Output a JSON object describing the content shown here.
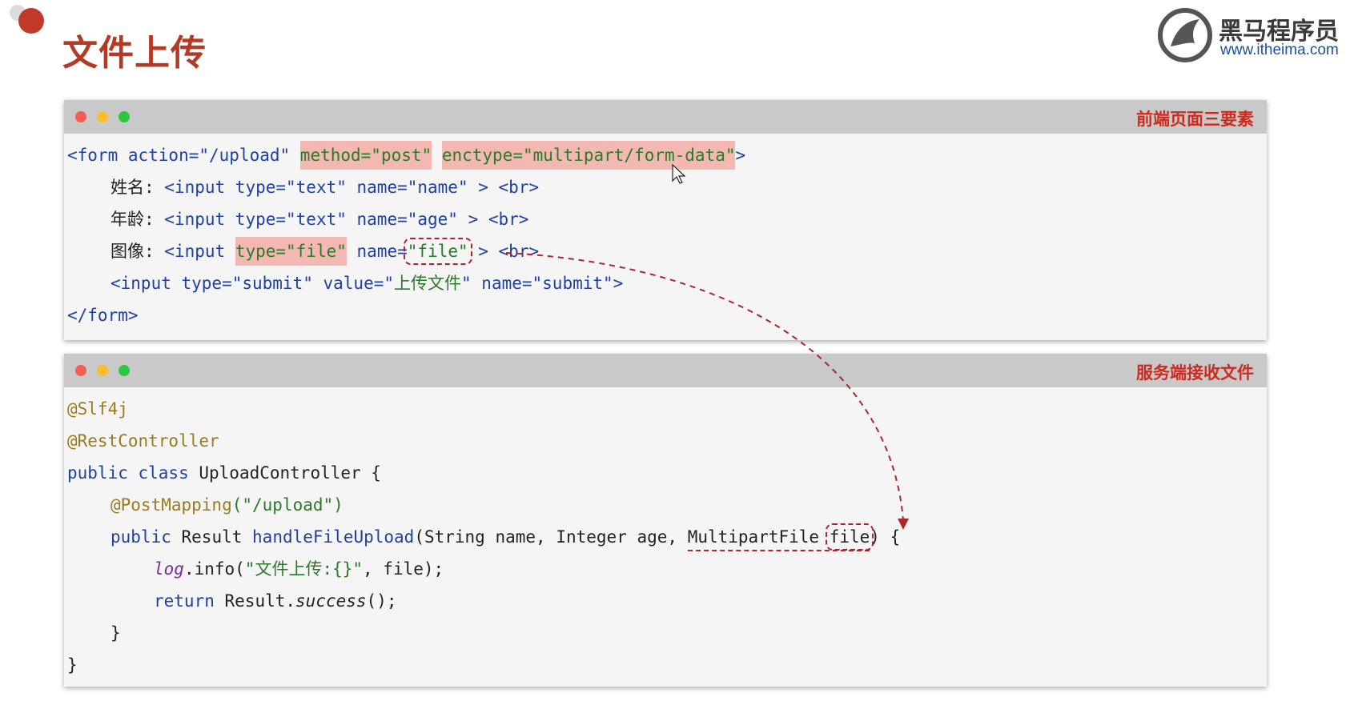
{
  "page": {
    "title": "文件上传"
  },
  "logo": {
    "name": "黑马程序员",
    "url": "www.itheima.com"
  },
  "window1": {
    "label": "前端页面三要素",
    "lines": {
      "l1": {
        "open": "<form action=\"/upload\" ",
        "method": "method=\"post\"",
        "sp": " ",
        "enctype": "enctype=\"multipart/form-data\"",
        "close": ">"
      },
      "l2": {
        "label": "姓名: ",
        "code": "<input type=\"text\" name=\"name\" > <br>"
      },
      "l3": {
        "label": "年龄: ",
        "code": "<input type=\"text\" name=\"age\" > <br>"
      },
      "l4": {
        "label": "图像: ",
        "pre": "<input ",
        "type": "type=\"file\"",
        "mid": " name=",
        "name": "\"file\"",
        "post": " > <br>"
      },
      "l5": {
        "pre": "<input type=\"submit\" value=\"",
        "value": "上传文件",
        "post": "\" name=\"submit\">"
      },
      "l6": {
        "code": "</form>"
      }
    }
  },
  "window2": {
    "label": "服务端接收文件",
    "lines": {
      "l1": "@Slf4j",
      "l2": "@RestController",
      "l3": {
        "kw": "public class ",
        "rest": "UploadController {"
      },
      "l4": {
        "ann": "@PostMapping",
        "rest": "(\"/upload\")"
      },
      "l5": {
        "kw": "public ",
        "type": "Result ",
        "method": "handleFileUpload",
        "args": "(String name, Integer age, ",
        "ptype": "MultipartFile ",
        "pname": "file",
        "end": ") {"
      },
      "l6": {
        "log": "log",
        "call": ".info(",
        "str": "\"文件上传:{}\"",
        "end": ", file);"
      },
      "l7": {
        "kw": "return ",
        "obj": "Result.",
        "m": "success",
        "end": "();"
      },
      "l8": "}",
      "l9": "}"
    }
  }
}
